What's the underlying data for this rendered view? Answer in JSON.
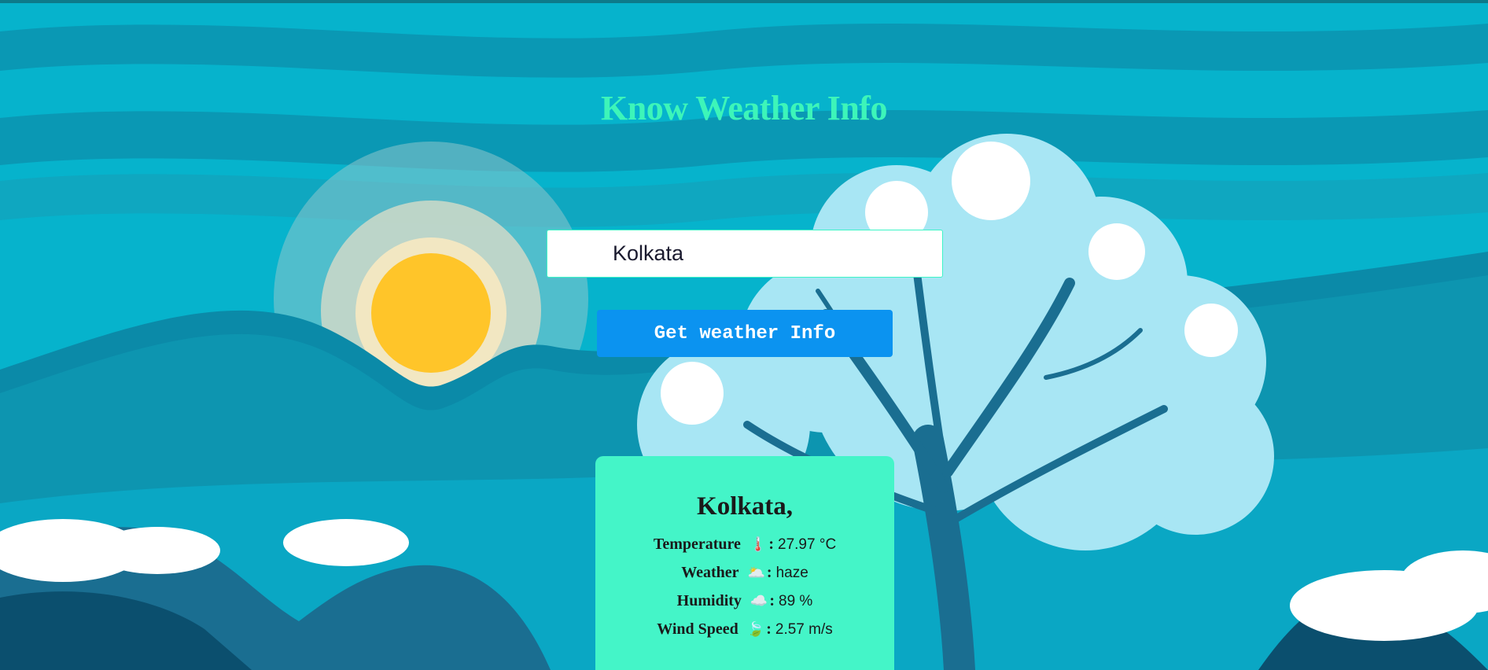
{
  "colors": {
    "title": "#3df5b9",
    "button_bg": "#0b93f0",
    "card_bg": "#44f5c8",
    "sky": "#04b4cc"
  },
  "page": {
    "title": "Know Weather Info"
  },
  "search": {
    "value": "Kolkata",
    "button_label": "Get weather Info"
  },
  "result": {
    "city": "Kolkata,",
    "rows": [
      {
        "label": "Temperature",
        "icon": "thermometer-icon",
        "glyph": "🌡️",
        "value": "27.97 °C"
      },
      {
        "label": "Weather",
        "icon": "sun-behind-cloud-icon",
        "glyph": "🌥️",
        "value": "haze"
      },
      {
        "label": "Humidity",
        "icon": "cloud-icon",
        "glyph": "☁️",
        "value": "89 %"
      },
      {
        "label": "Wind Speed",
        "icon": "leaf-icon",
        "glyph": "🍃",
        "value": "2.57 m/s"
      }
    ]
  }
}
